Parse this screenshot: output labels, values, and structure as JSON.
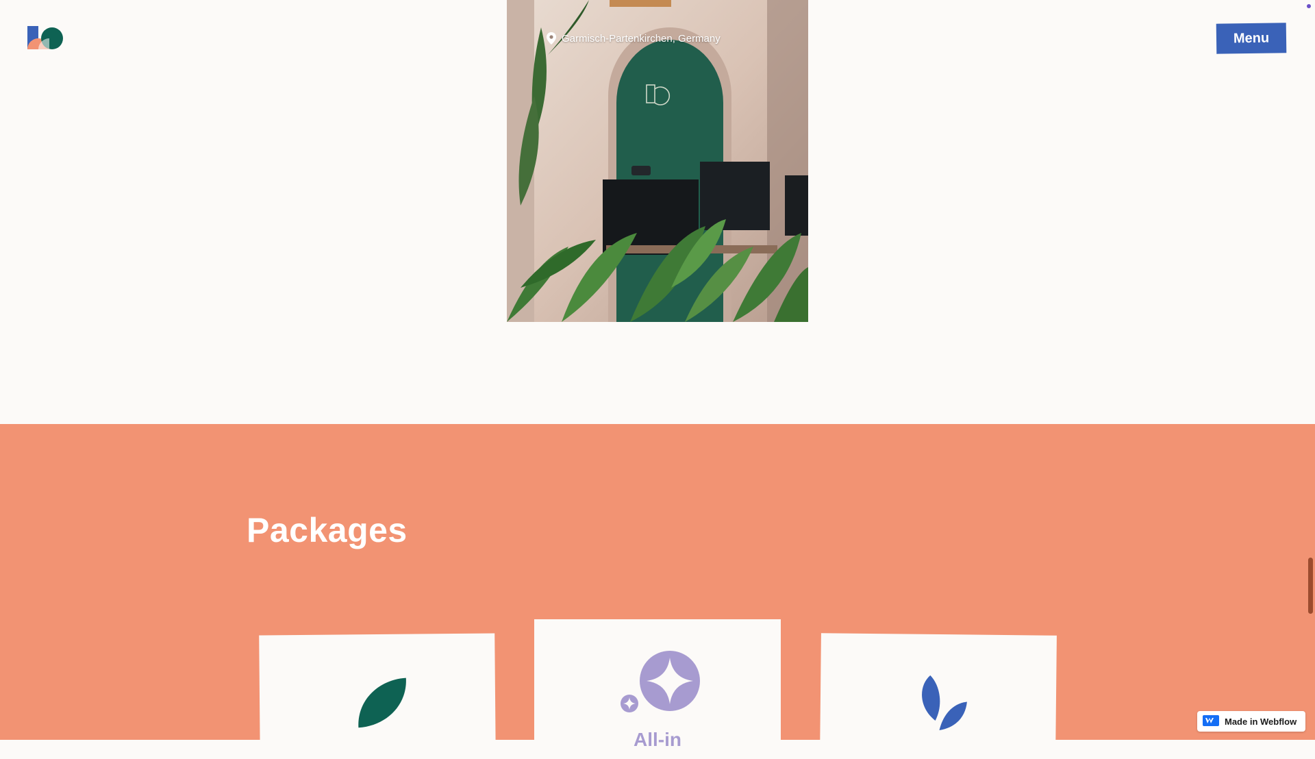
{
  "header": {
    "logo_icon": "brand-logo-icon",
    "menu_label": "Menu"
  },
  "hero": {
    "location_icon": "map-pin-icon",
    "location": "Garmisch-Partenkirchen, Germany"
  },
  "packages": {
    "title": "Packages",
    "cards": [
      {
        "icon": "leaf-icon",
        "title": ""
      },
      {
        "icon": "sparkle-star-icon",
        "title": "All-in"
      },
      {
        "icon": "twin-leaves-icon",
        "title": ""
      }
    ]
  },
  "badge": {
    "icon": "webflow-icon",
    "label": "Made in Webflow"
  },
  "colors": {
    "background": "#fcfaf8",
    "accent_blue": "#3a62b8",
    "coral": "#f29373",
    "teal": "#0e6253",
    "lavender": "#a79bd0"
  }
}
